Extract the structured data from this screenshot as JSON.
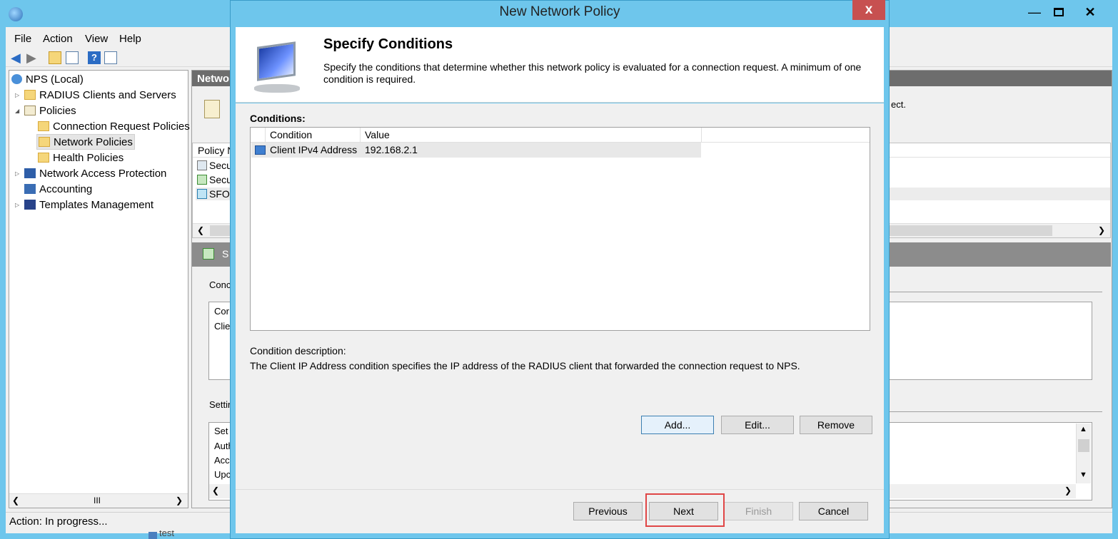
{
  "mmc": {
    "menu": [
      "File",
      "Action",
      "View",
      "Help"
    ],
    "tree": [
      {
        "label": "NPS (Local)"
      },
      {
        "label": "RADIUS Clients and Servers"
      },
      {
        "label": "Policies"
      },
      {
        "label": "Connection Request Policies"
      },
      {
        "label": "Network Policies"
      },
      {
        "label": "Health Policies"
      },
      {
        "label": "Network Access Protection"
      },
      {
        "label": "Accounting"
      },
      {
        "label": "Templates Management"
      }
    ],
    "right_pane": {
      "header_fragment": "Netwo",
      "text_fragment": "ect.",
      "list_header_fragment": "Policy N",
      "list_rows": [
        "Secu",
        "Secu",
        "SFO"
      ],
      "details_band_fragment": "S",
      "conditions_fragment": "Conc",
      "conditions_rows": [
        "Cor",
        "Clie"
      ],
      "settings_fragment": "Settin",
      "settings_rows": [
        "Set",
        "Auth",
        "Acc",
        "Upc"
      ],
      "bottom_fragment": "test"
    },
    "statusbar": "Action:  In progress...",
    "scroll_thumb": "III"
  },
  "dialog": {
    "title": "New Network Policy",
    "close_glyph": "x",
    "heading": "Specify Conditions",
    "subtitle": "Specify the conditions that determine whether this network policy is evaluated for a connection request. A minimum of one condition is required.",
    "conditions_label": "Conditions:",
    "columns": [
      "Condition",
      "Value"
    ],
    "rows": [
      {
        "condition": "Client IPv4 Address",
        "value": "192.168.2.1"
      }
    ],
    "description_label": "Condition description:",
    "description_text": "The Client IP Address condition specifies the IP address of the RADIUS client that forwarded the connection request to NPS.",
    "buttons": {
      "add": "Add...",
      "edit": "Edit...",
      "remove": "Remove",
      "previous": "Previous",
      "next": "Next",
      "finish": "Finish",
      "cancel": "Cancel"
    }
  },
  "colors": {
    "accent": "#6ec6ec",
    "highlight_box": "#e04646",
    "close_button": "#c75050"
  }
}
